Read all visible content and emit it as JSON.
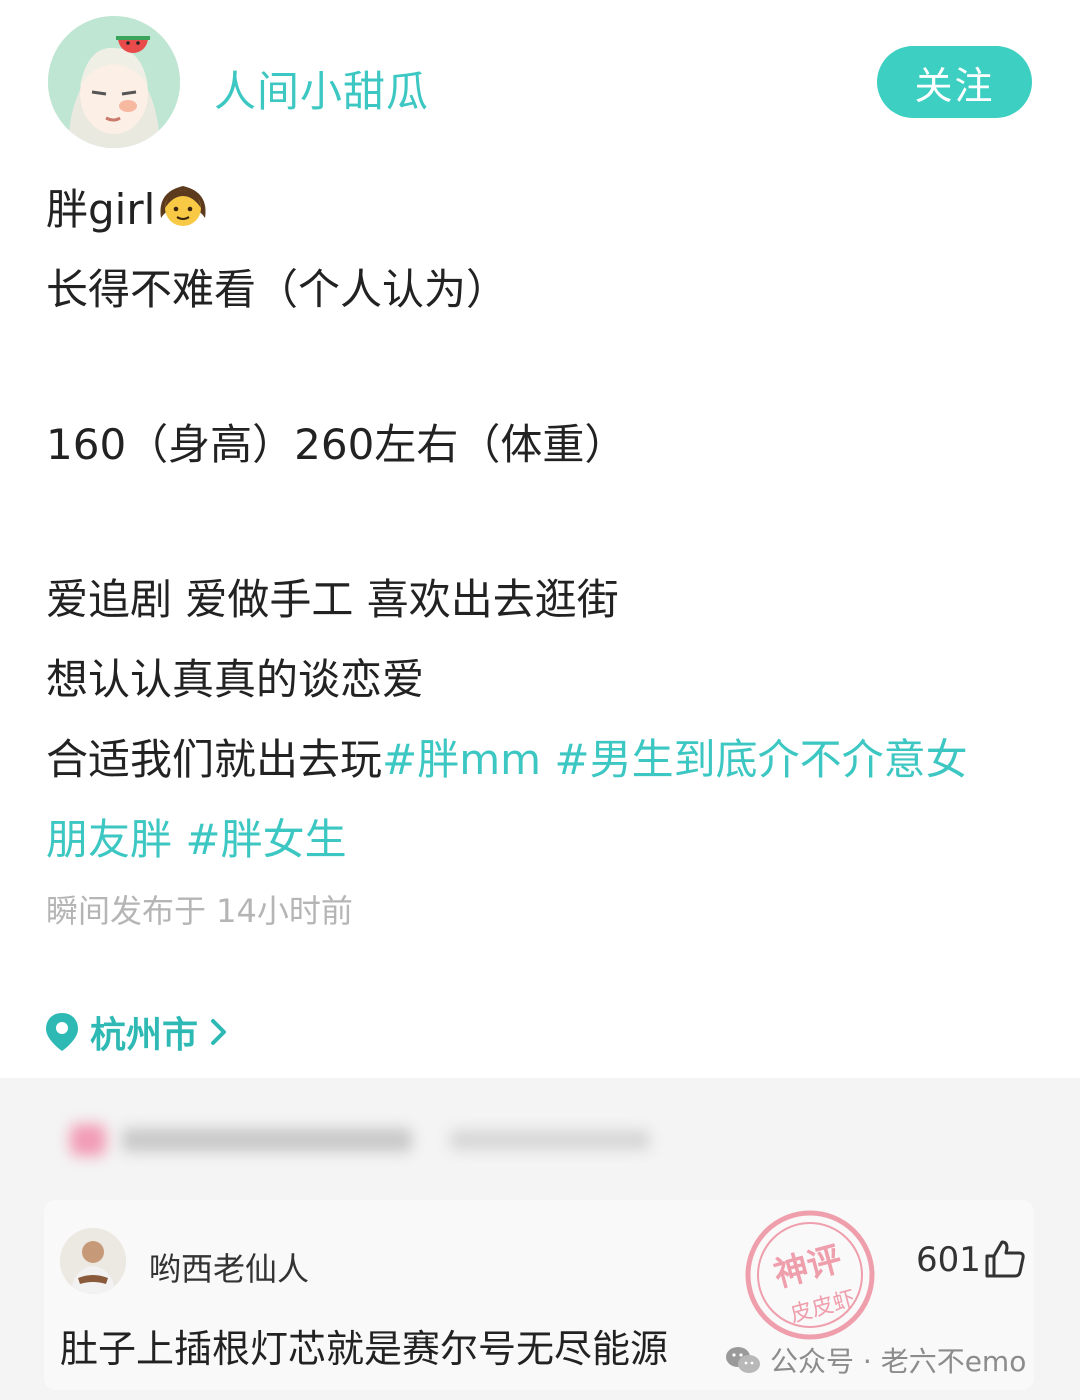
{
  "post": {
    "username": "人间小甜瓜",
    "follow_label": "关注",
    "lines": {
      "l1": "胖girl",
      "l2": "长得不难看（个人认为）",
      "l3": "160（身高）260左右（体重）",
      "l4": "爱追剧 爱做手工 喜欢出去逛街",
      "l5": "想认认真真的谈恋爱",
      "l6": "合适我们就出去玩"
    },
    "tags": {
      "t1": "#胖mm",
      "t2": "#男生到底介不介意女",
      "t2_cont": "朋友胖",
      "t3": "#胖女生"
    },
    "emoji": "girl-emoji",
    "timestamp": "瞬间发布于 14小时前",
    "location": "杭州市"
  },
  "comment": {
    "username": "哟西老仙人",
    "likes": "601",
    "text": "肚子上插根灯芯就是赛尔号无尽能源"
  },
  "watermark": {
    "text": "公众号 · 老六不emo",
    "stamp_top": "神评",
    "stamp_bottom": "皮皮虾"
  },
  "colors": {
    "accent": "#3cc7c2",
    "follow_bg": "#3ccfc2",
    "timestamp": "#b5b5b5",
    "comment_bg": "#f9f9f9",
    "band_bg": "#f4f4f4"
  }
}
